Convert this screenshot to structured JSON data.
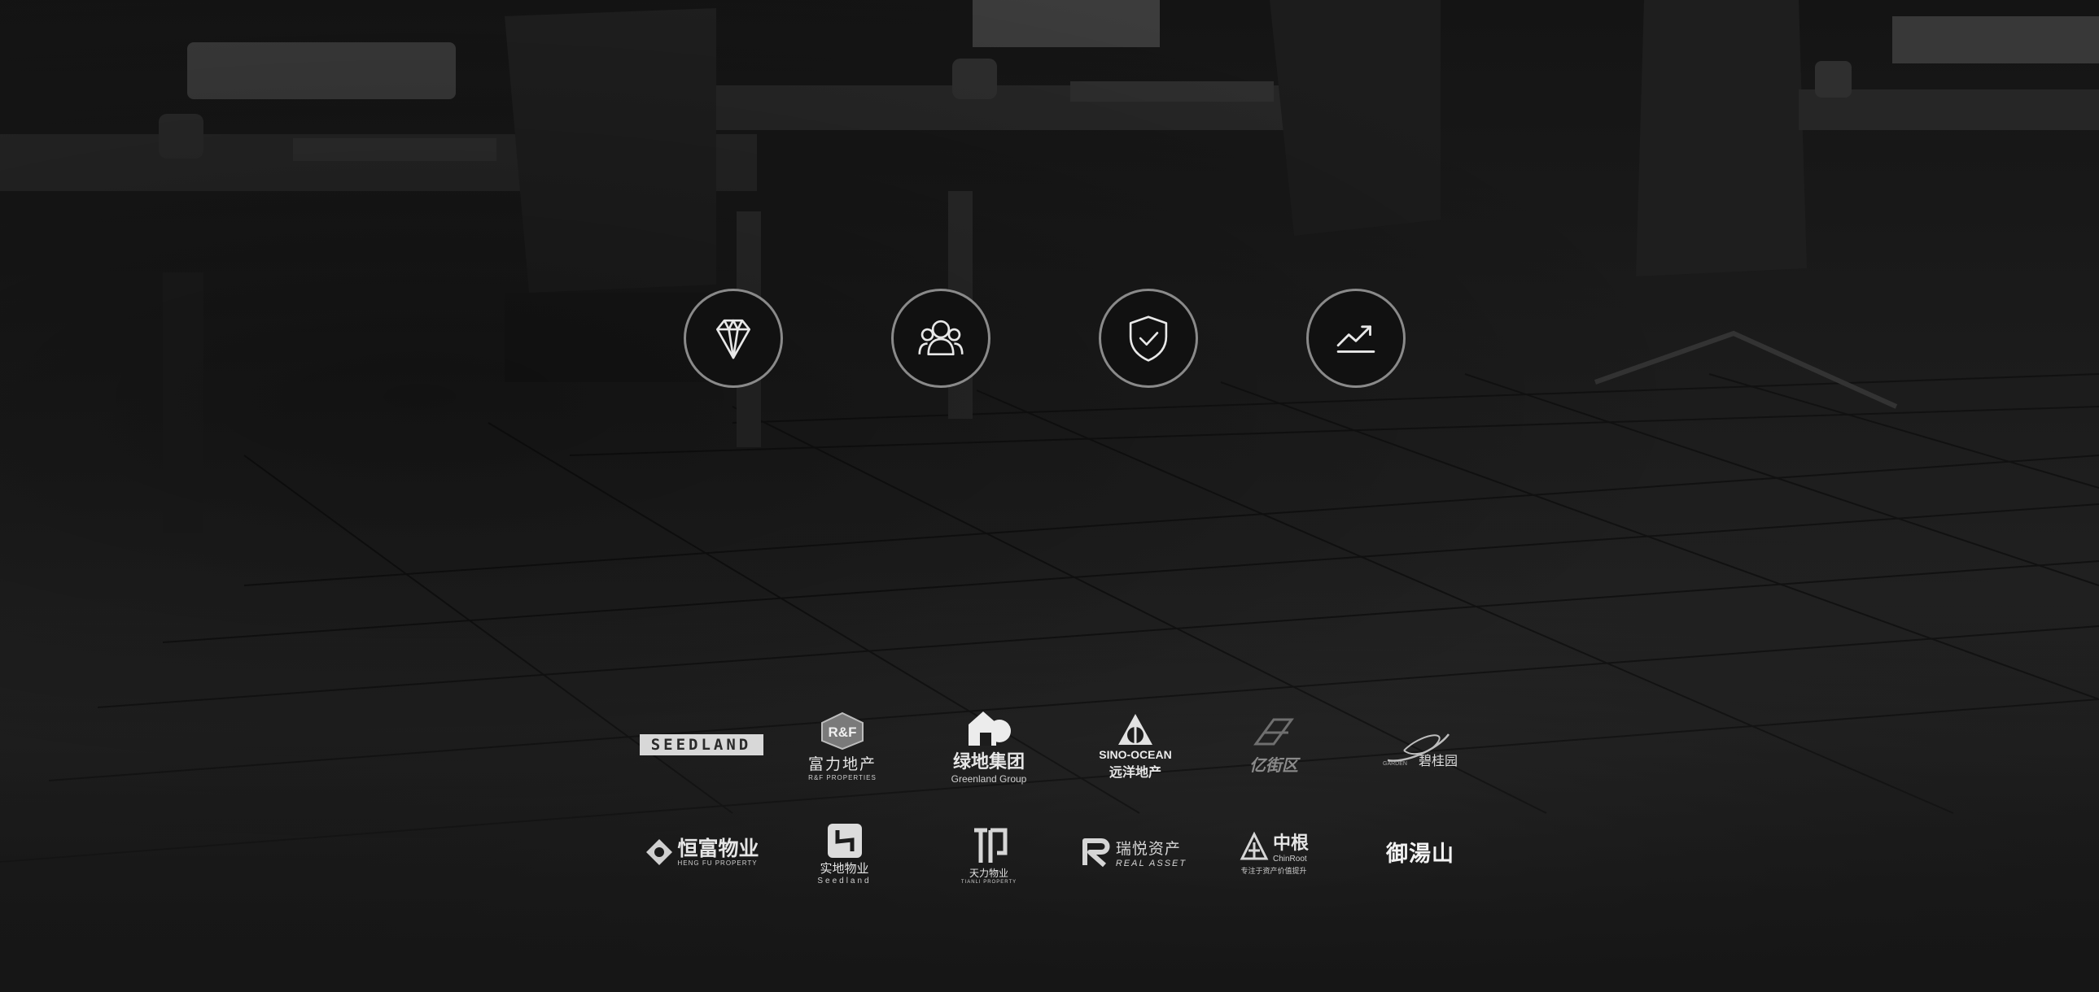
{
  "feature_icons": [
    {
      "icon": "diamond-icon"
    },
    {
      "icon": "people-group-icon"
    },
    {
      "icon": "shield-check-icon"
    },
    {
      "icon": "trend-up-icon"
    }
  ],
  "partners_row1": [
    {
      "name": "SEEDLAND"
    },
    {
      "mark": "R&F",
      "cn": "富力地产",
      "en": "R&F PROPERTIES"
    },
    {
      "cn": "绿地集团",
      "en": "Greenland Group"
    },
    {
      "en": "SINO-OCEAN",
      "cn": "远洋地产"
    },
    {
      "cn": "亿街区"
    },
    {
      "en": "GARDEN",
      "cn": "碧桂园"
    }
  ],
  "partners_row2": [
    {
      "cn": "恒富物业",
      "en": "HENG FU PROPERTY"
    },
    {
      "cn": "实地物业",
      "en": "Seedland"
    },
    {
      "cn": "天力物业",
      "en": "TIANLI PROPERTY"
    },
    {
      "cn": "瑞悦资产",
      "en": "REAL ASSET"
    },
    {
      "cn": "中根",
      "en": "ChinRoot",
      "tagline": "专注于资产价值提升"
    },
    {
      "cn": "御湯山"
    }
  ]
}
